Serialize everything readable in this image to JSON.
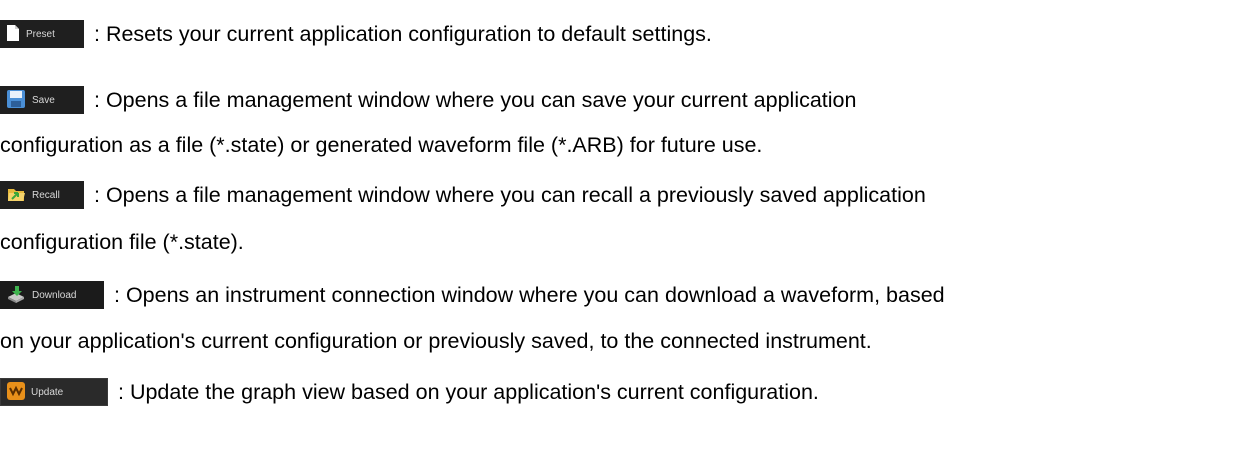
{
  "items": [
    {
      "button_label": "Preset",
      "icon": "document-icon",
      "lines": [
        ": Resets your current application configuration to default settings."
      ]
    },
    {
      "button_label": "Save",
      "icon": "floppy-disk-icon",
      "lines": [
        ": Opens a file management window where you can save your current application",
        "configuration as a file (*.state) or generated waveform file (*.ARB) for future use."
      ]
    },
    {
      "button_label": "Recall",
      "icon": "folder-arrow-icon",
      "lines": [
        ": Opens a file management window where you can recall a previously saved application",
        "configuration file (*.state)."
      ]
    },
    {
      "button_label": "Download",
      "icon": "download-instrument-icon",
      "lines": [
        ": Opens an instrument connection window where you can download a waveform, based",
        "on your application's current configuration or previously saved, to the connected instrument."
      ]
    },
    {
      "button_label": "Update",
      "icon": "waveform-update-icon",
      "lines": [
        ": Update the graph view based on your application's current configuration."
      ]
    }
  ]
}
